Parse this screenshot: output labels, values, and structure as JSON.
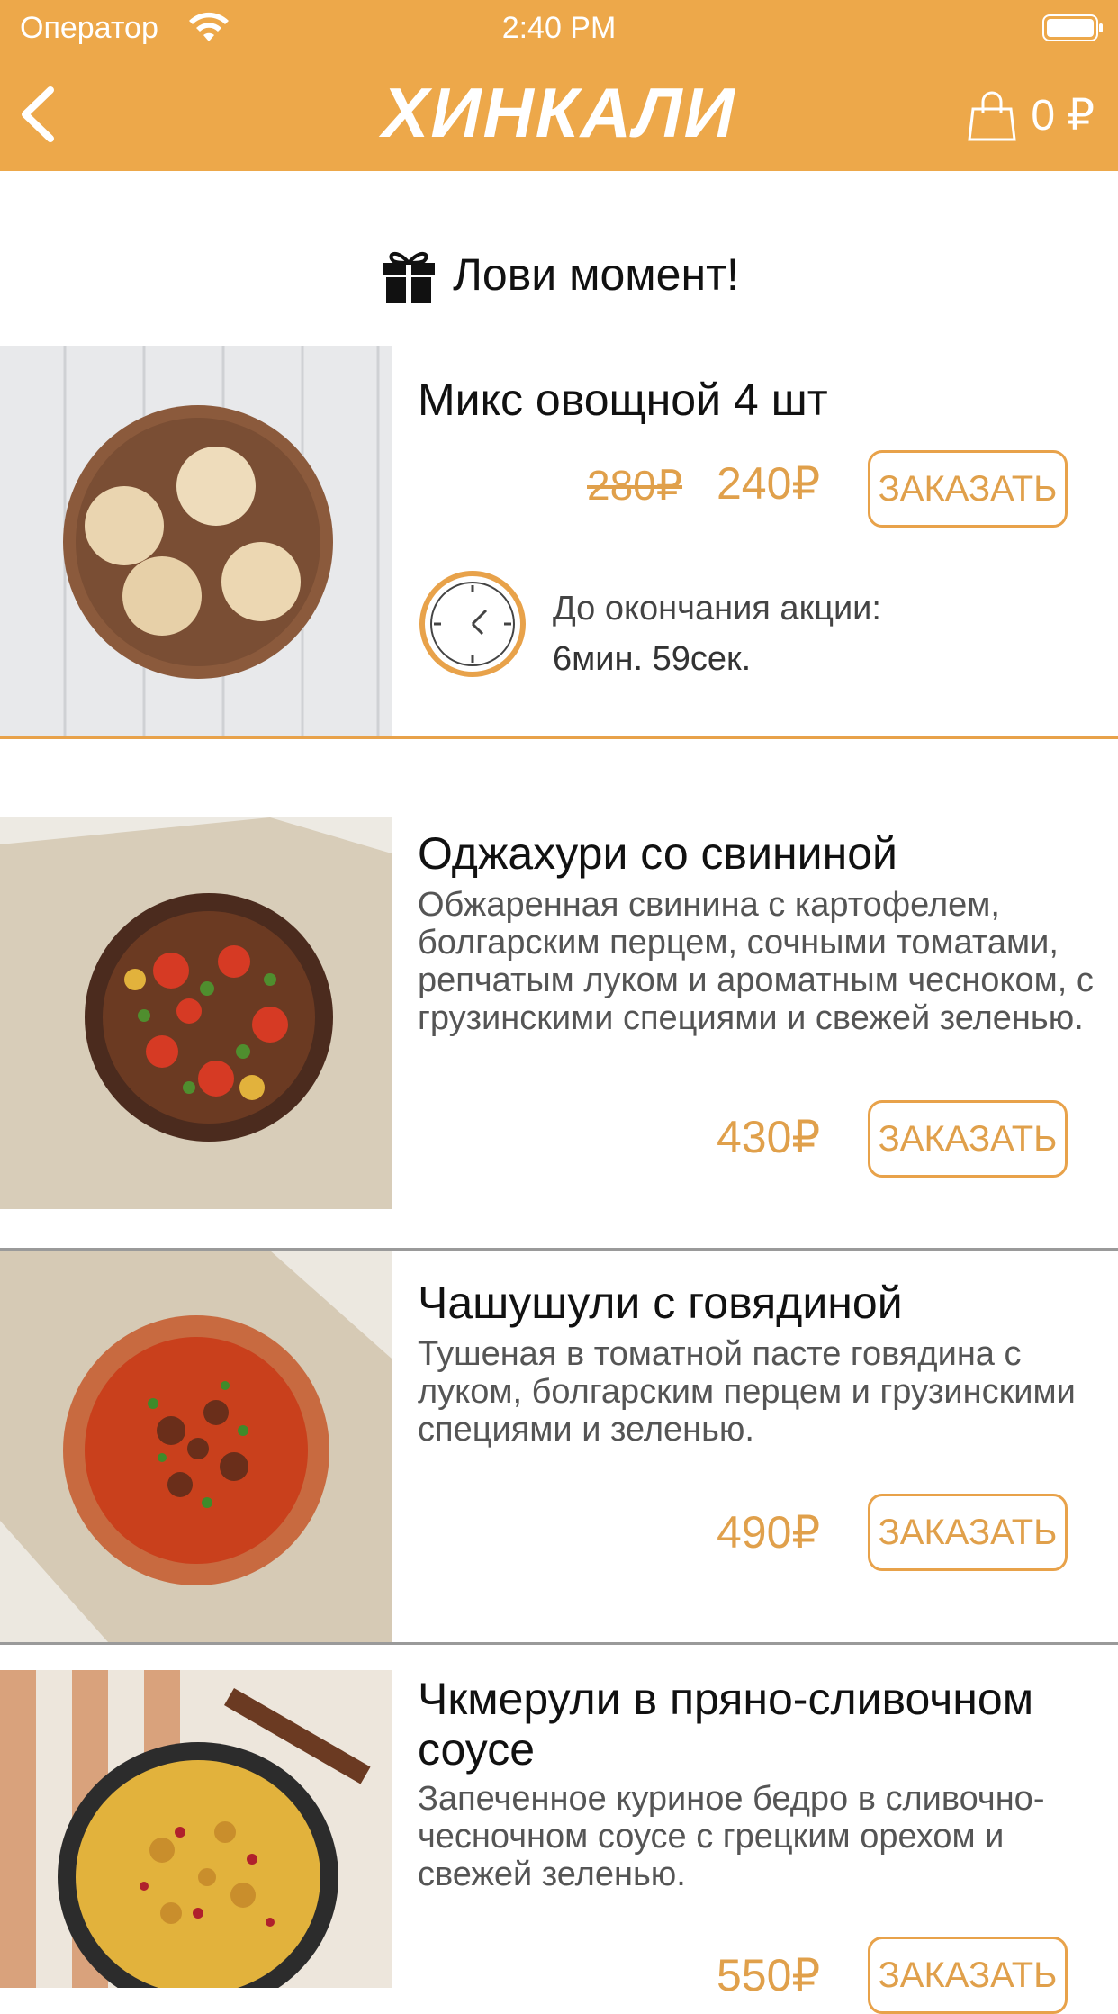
{
  "status_bar": {
    "carrier": "Оператор",
    "time": "2:40 PM"
  },
  "header": {
    "logo": "ХИНКАЛИ",
    "cart_amount": "0 ₽"
  },
  "promo": {
    "title": "Лови момент!",
    "item": {
      "name": "Микс овощной 4 шт",
      "old_price": "280₽",
      "price": "240₽",
      "order_label": "ЗАКАЗАТЬ",
      "timer_label": "До окончания акции:",
      "timer_value": "6мин. 59сек."
    }
  },
  "menu": [
    {
      "name": "Оджахури со свининой",
      "description": "Обжаренная свинина с картофелем, болгарским перцем, сочными томатами, репчатым луком и ароматным чесноком, с грузинскими специями и свежей зеленью.",
      "price": "430₽",
      "order_label": "ЗАКАЗАТЬ"
    },
    {
      "name": "Чашушули с говядиной",
      "description": "Тушеная в томатной пасте говядина с луком, болгарским перцем и грузинскими специями и зеленью.",
      "price": "490₽",
      "order_label": "ЗАКАЗАТЬ"
    },
    {
      "name": "Чкмерули в пряно-сливочном соусе",
      "description": "Запеченное куриное бедро в сливочно-чесночном соусе с грецким орехом и свежей зеленью.",
      "price": "550₽",
      "order_label": "ЗАКАЗАТЬ"
    }
  ],
  "colors": {
    "accent": "#EDA84A",
    "price": "#E0A04B"
  }
}
